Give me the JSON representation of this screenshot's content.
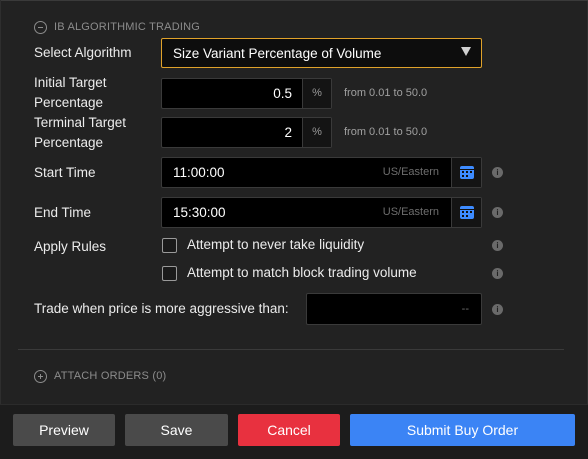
{
  "section": {
    "title": "IB ALGORITHMIC TRADING",
    "toggle_icon": "collapse-minus-icon"
  },
  "algorithm": {
    "label": "Select Algorithm",
    "selected": "Size Variant Percentage of Volume",
    "caret_icon": "dropdown-caret-icon",
    "border_color": "#e0a22a"
  },
  "initial_target": {
    "label_line1": "Initial Target",
    "label_line2": "Percentage",
    "value": "0.5",
    "unit": "%",
    "hint": "from 0.01 to 50.0"
  },
  "terminal_target": {
    "label_line1": "Terminal Target",
    "label_line2": "Percentage",
    "value": "2",
    "unit": "%",
    "hint": "from 0.01 to 50.0"
  },
  "start_time": {
    "label": "Start Time",
    "value": "11:00:00",
    "timezone": "US/Eastern",
    "icon": "calendar-icon"
  },
  "end_time": {
    "label": "End Time",
    "value": "15:30:00",
    "timezone": "US/Eastern",
    "icon": "calendar-icon"
  },
  "apply_rules": {
    "label": "Apply Rules",
    "options": [
      {
        "label": "Attempt to never take liquidity",
        "checked": false
      },
      {
        "label": "Attempt to match block trading volume",
        "checked": false
      }
    ]
  },
  "aggressive": {
    "label": "Trade when price is more aggressive than:",
    "value": "--"
  },
  "attach_orders": {
    "title": "ATTACH ORDERS (0)",
    "toggle_icon": "expand-plus-icon"
  },
  "info_icon": "i",
  "buttons": {
    "preview": "Preview",
    "save": "Save",
    "cancel": "Cancel",
    "submit": "Submit Buy Order"
  },
  "colors": {
    "cancel": "#e8313f",
    "submit": "#3b84f5",
    "calendar": "#3d8bff"
  }
}
